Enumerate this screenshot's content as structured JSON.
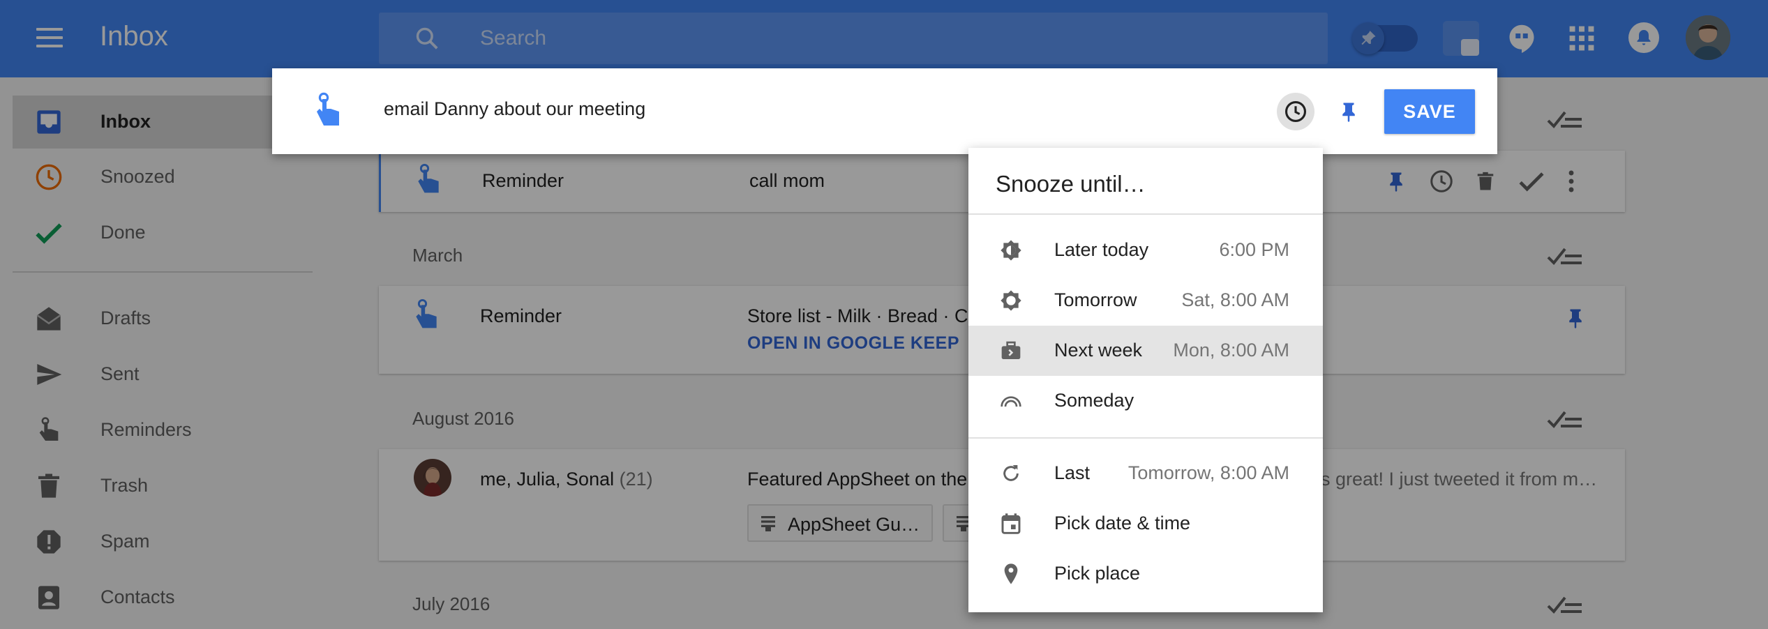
{
  "header": {
    "title": "Inbox",
    "search_placeholder": "Search"
  },
  "sidebar": {
    "items": [
      {
        "label": "Inbox"
      },
      {
        "label": "Snoozed"
      },
      {
        "label": "Done"
      },
      {
        "label": "Drafts"
      },
      {
        "label": "Sent"
      },
      {
        "label": "Reminders"
      },
      {
        "label": "Trash"
      },
      {
        "label": "Spam"
      },
      {
        "label": "Contacts"
      }
    ]
  },
  "list": {
    "reminder1": {
      "sender": "Reminder",
      "subject": "call mom"
    },
    "sections": [
      "March",
      "August 2016",
      "July 2016"
    ],
    "reminder2": {
      "sender": "Reminder",
      "subject": "Store list - Milk · Bread · Ch",
      "link": "OPEN IN GOOGLE KEEP"
    },
    "thread": {
      "sender": "me, Julia, Sonal",
      "count": "(21)",
      "subject": "Featured AppSheet on the",
      "snippet": "s great! I just tweeted it from m…",
      "chip1": "AppSheet Gu…"
    }
  },
  "compose": {
    "text": "email Danny about our meeting",
    "save_label": "SAVE"
  },
  "snooze": {
    "title": "Snooze until…",
    "options": [
      {
        "label": "Later today",
        "time": "6:00 PM"
      },
      {
        "label": "Tomorrow",
        "time": "Sat, 8:00 AM"
      },
      {
        "label": "Next week",
        "time": "Mon, 8:00 AM"
      },
      {
        "label": "Someday",
        "time": ""
      },
      {
        "label": "Last",
        "time": "Tomorrow, 8:00 AM"
      },
      {
        "label": "Pick date & time",
        "time": ""
      },
      {
        "label": "Pick place",
        "time": ""
      }
    ]
  },
  "colors": {
    "brand": "#4285f4",
    "snoozed": "#ef6c00",
    "done": "#0f9d58",
    "reminder": "#4285f4",
    "link": "#3367d6"
  }
}
